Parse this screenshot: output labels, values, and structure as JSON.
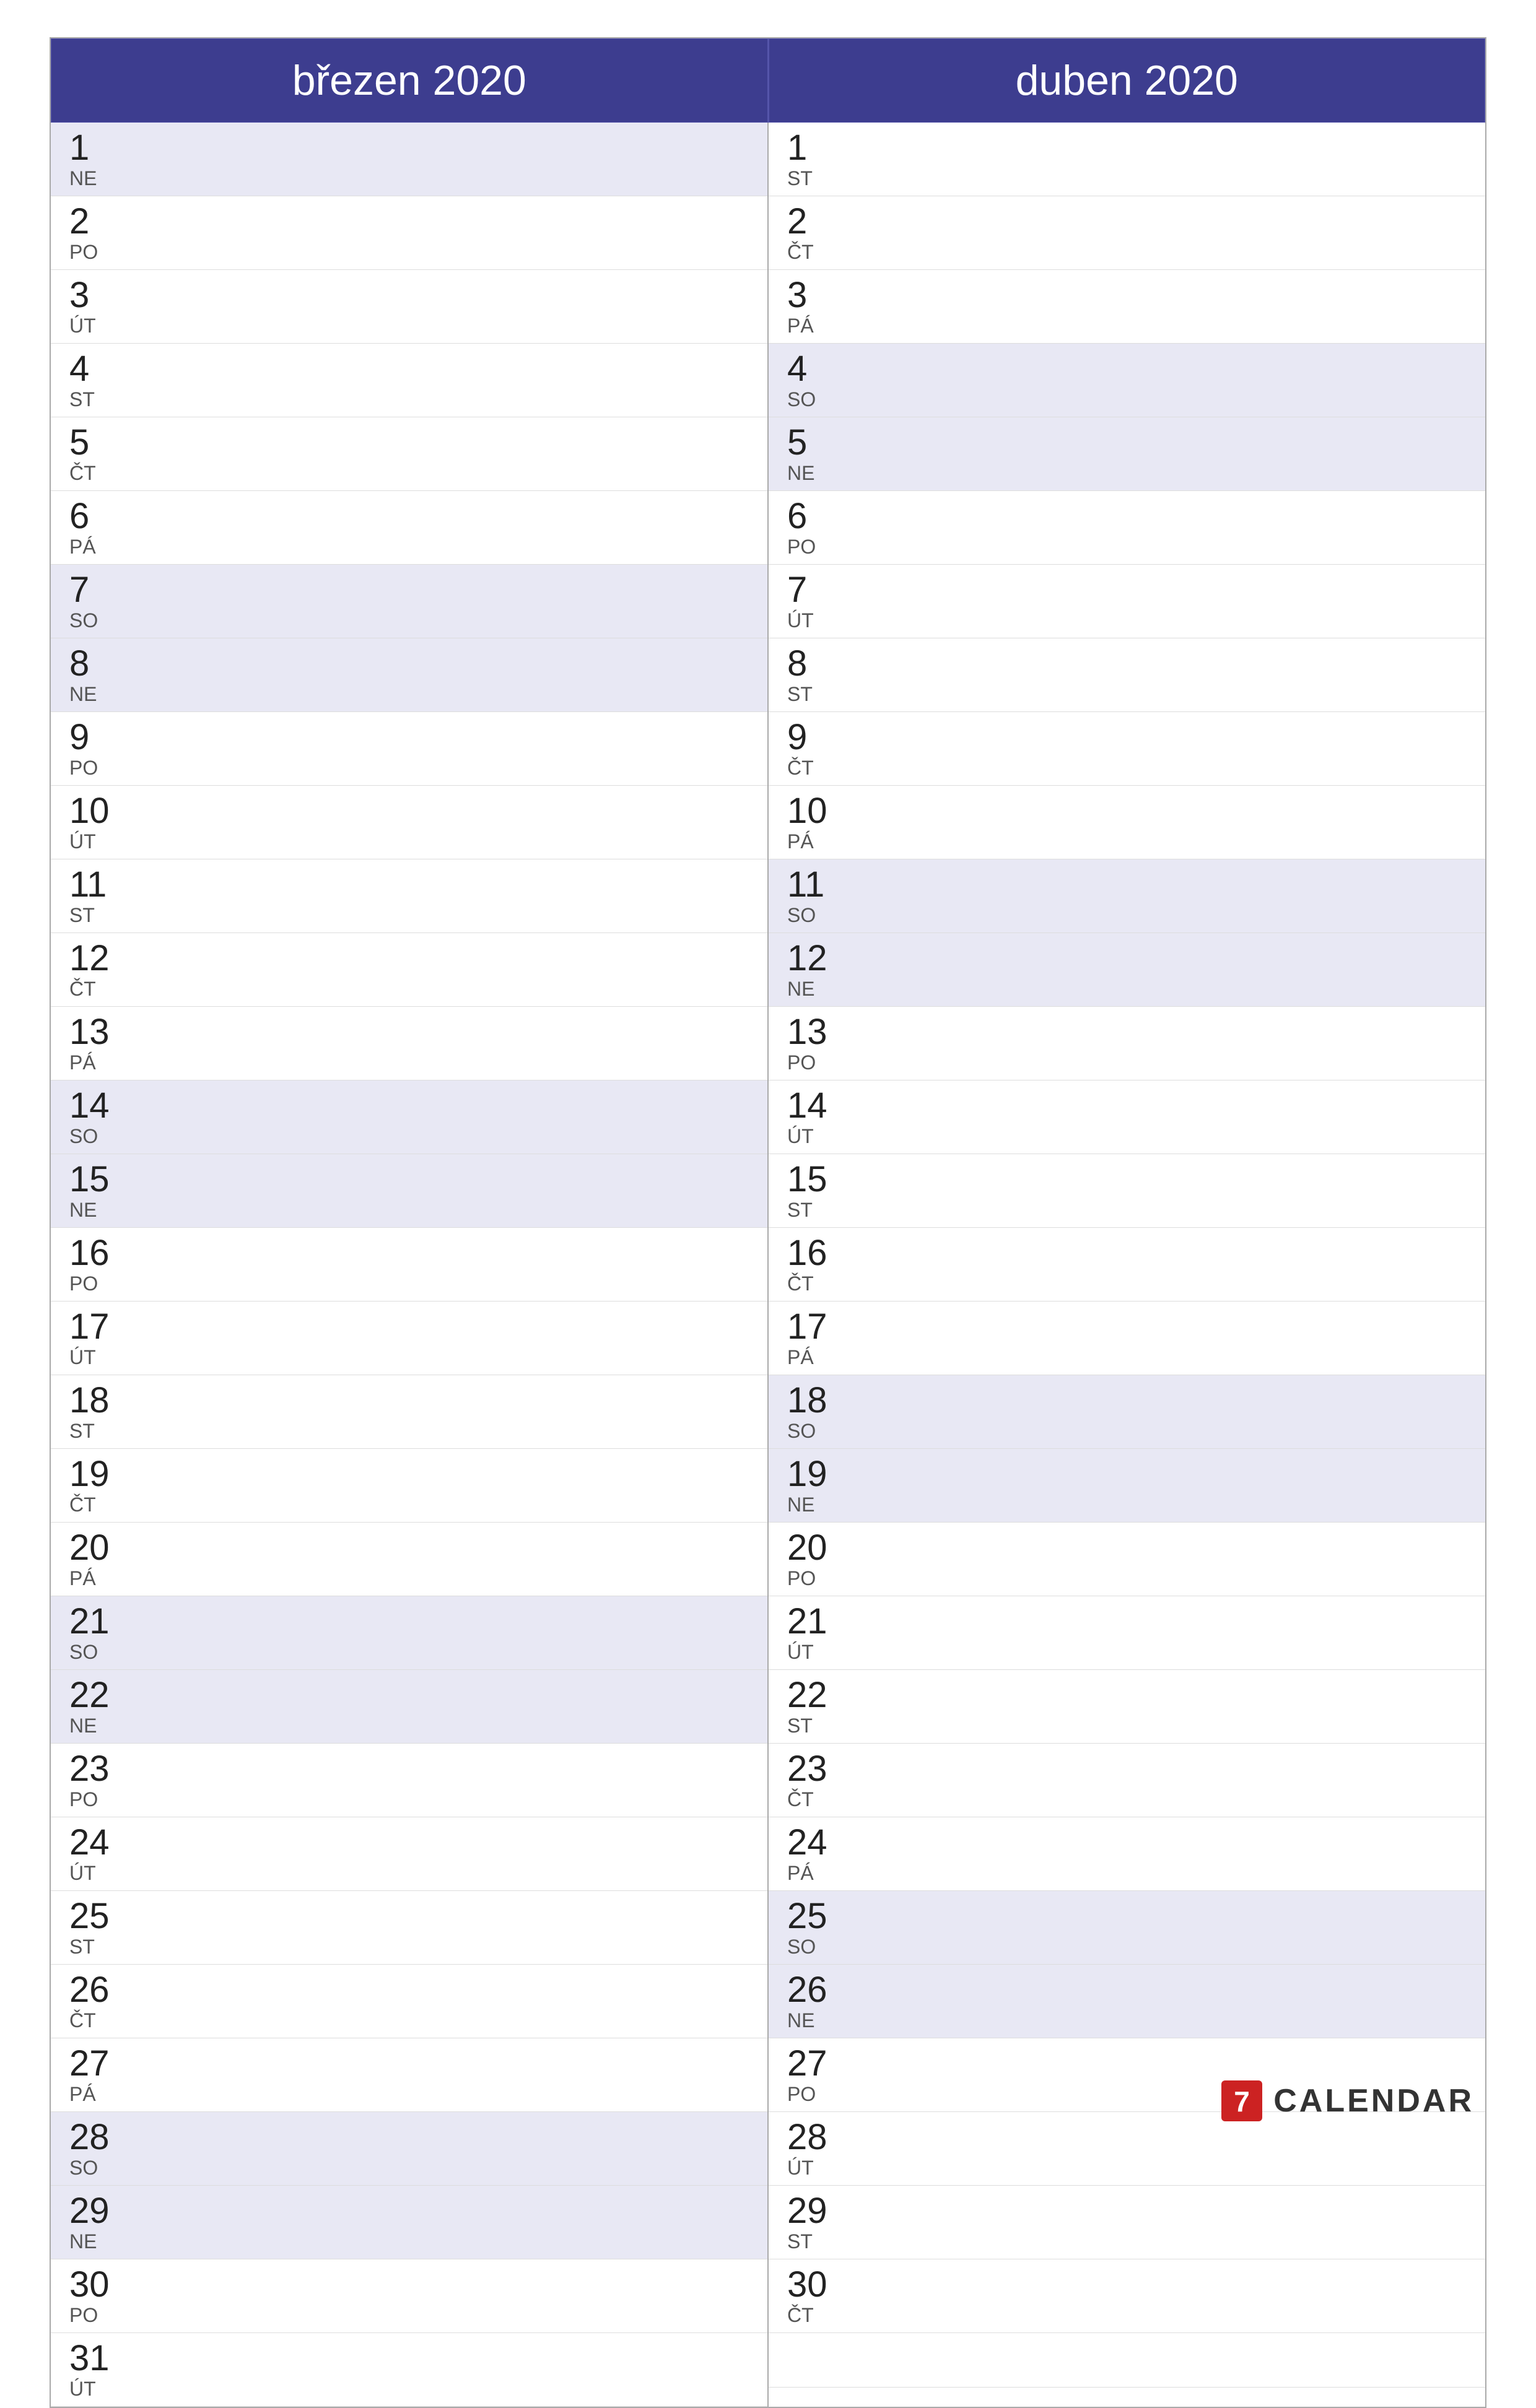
{
  "months": [
    {
      "name": "březen 2020",
      "days": [
        {
          "num": "1",
          "name": "NE",
          "weekend": true
        },
        {
          "num": "2",
          "name": "PO",
          "weekend": false
        },
        {
          "num": "3",
          "name": "ÚT",
          "weekend": false
        },
        {
          "num": "4",
          "name": "ST",
          "weekend": false
        },
        {
          "num": "5",
          "name": "ČT",
          "weekend": false
        },
        {
          "num": "6",
          "name": "PÁ",
          "weekend": false
        },
        {
          "num": "7",
          "name": "SO",
          "weekend": true
        },
        {
          "num": "8",
          "name": "NE",
          "weekend": true
        },
        {
          "num": "9",
          "name": "PO",
          "weekend": false
        },
        {
          "num": "10",
          "name": "ÚT",
          "weekend": false
        },
        {
          "num": "11",
          "name": "ST",
          "weekend": false
        },
        {
          "num": "12",
          "name": "ČT",
          "weekend": false
        },
        {
          "num": "13",
          "name": "PÁ",
          "weekend": false
        },
        {
          "num": "14",
          "name": "SO",
          "weekend": true
        },
        {
          "num": "15",
          "name": "NE",
          "weekend": true
        },
        {
          "num": "16",
          "name": "PO",
          "weekend": false
        },
        {
          "num": "17",
          "name": "ÚT",
          "weekend": false
        },
        {
          "num": "18",
          "name": "ST",
          "weekend": false
        },
        {
          "num": "19",
          "name": "ČT",
          "weekend": false
        },
        {
          "num": "20",
          "name": "PÁ",
          "weekend": false
        },
        {
          "num": "21",
          "name": "SO",
          "weekend": true
        },
        {
          "num": "22",
          "name": "NE",
          "weekend": true
        },
        {
          "num": "23",
          "name": "PO",
          "weekend": false
        },
        {
          "num": "24",
          "name": "ÚT",
          "weekend": false
        },
        {
          "num": "25",
          "name": "ST",
          "weekend": false
        },
        {
          "num": "26",
          "name": "ČT",
          "weekend": false
        },
        {
          "num": "27",
          "name": "PÁ",
          "weekend": false
        },
        {
          "num": "28",
          "name": "SO",
          "weekend": true
        },
        {
          "num": "29",
          "name": "NE",
          "weekend": true
        },
        {
          "num": "30",
          "name": "PO",
          "weekend": false
        },
        {
          "num": "31",
          "name": "ÚT",
          "weekend": false
        }
      ]
    },
    {
      "name": "duben 2020",
      "days": [
        {
          "num": "1",
          "name": "ST",
          "weekend": false
        },
        {
          "num": "2",
          "name": "ČT",
          "weekend": false
        },
        {
          "num": "3",
          "name": "PÁ",
          "weekend": false
        },
        {
          "num": "4",
          "name": "SO",
          "weekend": true
        },
        {
          "num": "5",
          "name": "NE",
          "weekend": true
        },
        {
          "num": "6",
          "name": "PO",
          "weekend": false
        },
        {
          "num": "7",
          "name": "ÚT",
          "weekend": false
        },
        {
          "num": "8",
          "name": "ST",
          "weekend": false
        },
        {
          "num": "9",
          "name": "ČT",
          "weekend": false
        },
        {
          "num": "10",
          "name": "PÁ",
          "weekend": false
        },
        {
          "num": "11",
          "name": "SO",
          "weekend": true
        },
        {
          "num": "12",
          "name": "NE",
          "weekend": true
        },
        {
          "num": "13",
          "name": "PO",
          "weekend": false
        },
        {
          "num": "14",
          "name": "ÚT",
          "weekend": false
        },
        {
          "num": "15",
          "name": "ST",
          "weekend": false
        },
        {
          "num": "16",
          "name": "ČT",
          "weekend": false
        },
        {
          "num": "17",
          "name": "PÁ",
          "weekend": false
        },
        {
          "num": "18",
          "name": "SO",
          "weekend": true
        },
        {
          "num": "19",
          "name": "NE",
          "weekend": true
        },
        {
          "num": "20",
          "name": "PO",
          "weekend": false
        },
        {
          "num": "21",
          "name": "ÚT",
          "weekend": false
        },
        {
          "num": "22",
          "name": "ST",
          "weekend": false
        },
        {
          "num": "23",
          "name": "ČT",
          "weekend": false
        },
        {
          "num": "24",
          "name": "PÁ",
          "weekend": false
        },
        {
          "num": "25",
          "name": "SO",
          "weekend": true
        },
        {
          "num": "26",
          "name": "NE",
          "weekend": true
        },
        {
          "num": "27",
          "name": "PO",
          "weekend": false
        },
        {
          "num": "28",
          "name": "ÚT",
          "weekend": false
        },
        {
          "num": "29",
          "name": "ST",
          "weekend": false
        },
        {
          "num": "30",
          "name": "ČT",
          "weekend": false
        }
      ]
    }
  ],
  "logo": {
    "text": "CALENDAR",
    "accent_color": "#cc2222"
  }
}
